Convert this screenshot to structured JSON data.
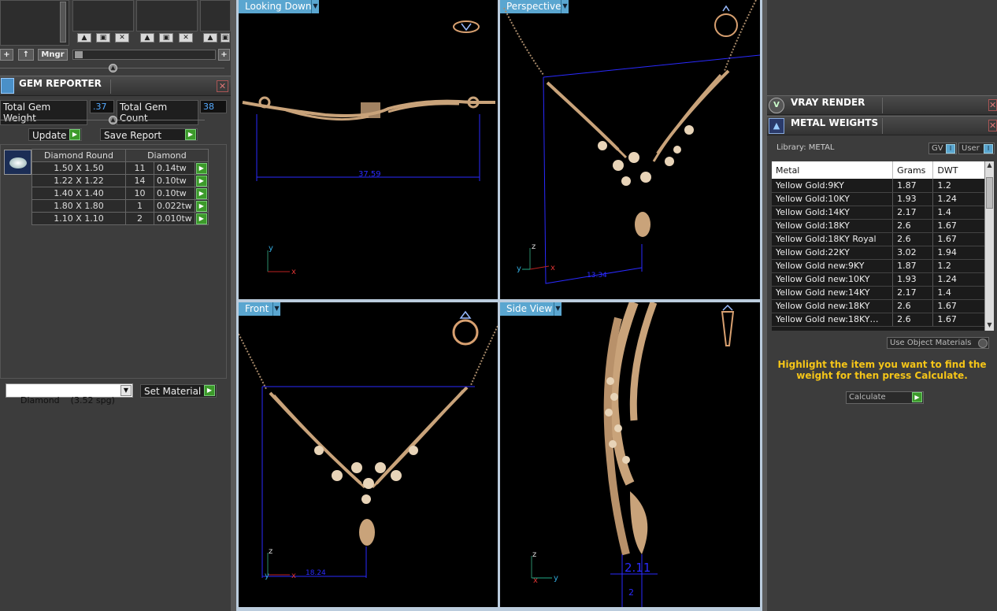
{
  "top_toolbar": {
    "add_label": "+",
    "up_label": "↑",
    "mngr_label": "Mngr",
    "plus_right": "+"
  },
  "gem_reporter": {
    "title": "GEM REPORTER",
    "total_weight_label": "Total Gem Weight",
    "total_weight_value": ".37",
    "total_count_label": "Total Gem Count",
    "total_count_value": "38",
    "update_label": "Update",
    "save_report_label": "Save Report",
    "table_headers": [
      "Diamond Round",
      "Diamond"
    ],
    "rows": [
      {
        "size": "1.50 X 1.50",
        "count": "11",
        "weight": "0.14tw"
      },
      {
        "size": "1.22 X 1.22",
        "count": "14",
        "weight": "0.10tw"
      },
      {
        "size": "1.40 X 1.40",
        "count": "10",
        "weight": "0.10tw"
      },
      {
        "size": "1.80 X 1.80",
        "count": "1",
        "weight": "0.022tw"
      },
      {
        "size": "1.10 X 1.10",
        "count": "2",
        "weight": "0.010tw"
      }
    ],
    "material_select": "Diamond    (3.52 spg)",
    "set_material_label": "Set Material"
  },
  "viewports": {
    "top_left": {
      "label": "Looking Down",
      "dimension": "37.59",
      "axis_v": "y",
      "axis_h": "x"
    },
    "top_right": {
      "label": "Perspective",
      "dimension": "13.34",
      "axis_v": "z",
      "axis_h": "x",
      "axis_d": "y"
    },
    "bottom_left": {
      "label": "Front",
      "dimension": "18.24",
      "axis_v": "z",
      "axis_h": "x",
      "axis_d": "y"
    },
    "bottom_right": {
      "label": "Side View",
      "dimension": "2.11",
      "dimension2": "2",
      "axis_v": "z",
      "axis_h": "y",
      "axis_d": "x"
    }
  },
  "vray": {
    "title": "VRAY RENDER"
  },
  "metal_weights": {
    "title": "METAL WEIGHTS",
    "library_label": "Library: METAL",
    "gv_label": "GV",
    "user_label": "User",
    "headers": [
      "Metal",
      "Grams",
      "DWT"
    ],
    "rows": [
      {
        "metal": "Yellow Gold:9KY",
        "grams": "1.87",
        "dwt": "1.2"
      },
      {
        "metal": "Yellow Gold:10KY",
        "grams": "1.93",
        "dwt": "1.24"
      },
      {
        "metal": "Yellow Gold:14KY",
        "grams": "2.17",
        "dwt": "1.4"
      },
      {
        "metal": "Yellow Gold:18KY",
        "grams": "2.6",
        "dwt": "1.67"
      },
      {
        "metal": "Yellow Gold:18KY Royal",
        "grams": "2.6",
        "dwt": "1.67"
      },
      {
        "metal": "Yellow Gold:22KY",
        "grams": "3.02",
        "dwt": "1.94"
      },
      {
        "metal": "Yellow Gold new:9KY",
        "grams": "1.87",
        "dwt": "1.2"
      },
      {
        "metal": "Yellow Gold new:10KY",
        "grams": "1.93",
        "dwt": "1.24"
      },
      {
        "metal": "Yellow Gold new:14KY",
        "grams": "2.17",
        "dwt": "1.4"
      },
      {
        "metal": "Yellow Gold new:18KY",
        "grams": "2.6",
        "dwt": "1.67"
      },
      {
        "metal": "Yellow Gold new:18KY…",
        "grams": "2.6",
        "dwt": "1.67"
      }
    ],
    "use_object_materials_label": "Use Object Materials",
    "instruction": "Highlight the item you want to find the weight for then press Calculate.",
    "calculate_label": "Calculate"
  },
  "colors": {
    "viewport_label": "#5aa6d0",
    "instruction_text": "#f5c518",
    "gold": "#c9a37a",
    "dimension_blue": "#2a2aff"
  }
}
